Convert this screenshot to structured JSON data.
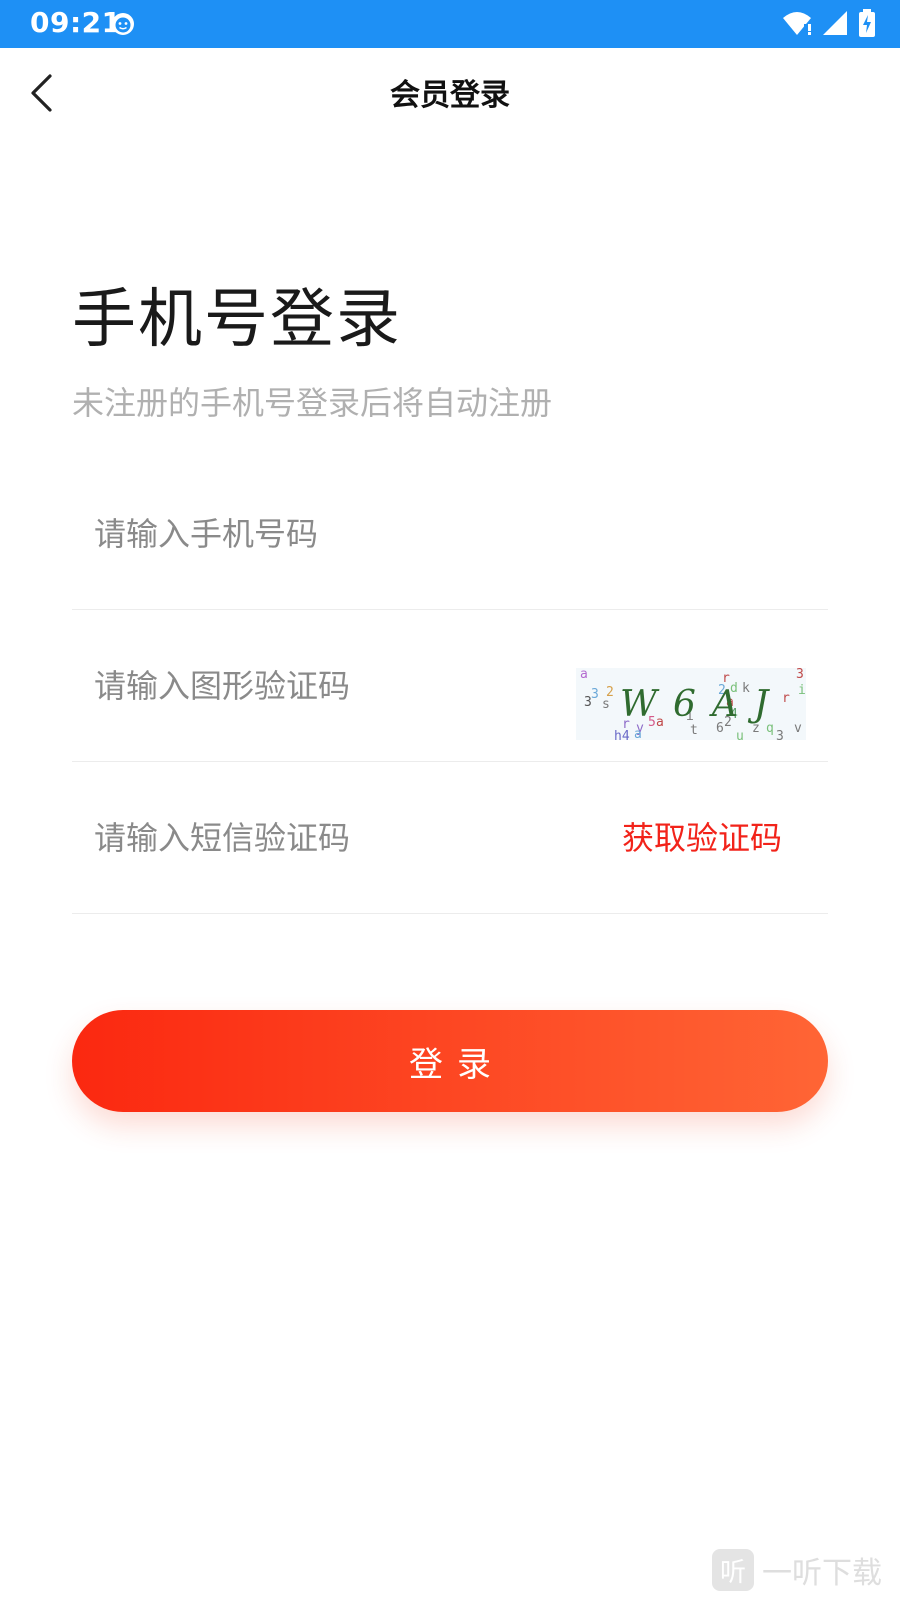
{
  "status_bar": {
    "time": "09:21",
    "background": "#1e90f5",
    "icons": [
      "app-notification-icon",
      "wifi-icon",
      "cell-signal-icon",
      "battery-charging-icon"
    ]
  },
  "nav": {
    "back_icon": "chevron-left-icon",
    "title": "会员登录"
  },
  "login": {
    "heading": "手机号登录",
    "subtitle": "未注册的手机号登录后将自动注册",
    "phone_placeholder": "请输入手机号码",
    "captcha_placeholder": "请输入图形验证码",
    "captcha_text": "W6AJ",
    "sms_placeholder": "请输入短信验证码",
    "get_code_label": "获取验证码",
    "submit_label": "登录"
  },
  "colors": {
    "accent": "#f2231a",
    "button_gradient_start": "#fb2810",
    "button_gradient_end": "#ff6535",
    "placeholder": "#8a8a8a",
    "subtitle": "#b0b0b0"
  },
  "watermark": {
    "logo_glyph": "听",
    "text": "一听下载"
  }
}
